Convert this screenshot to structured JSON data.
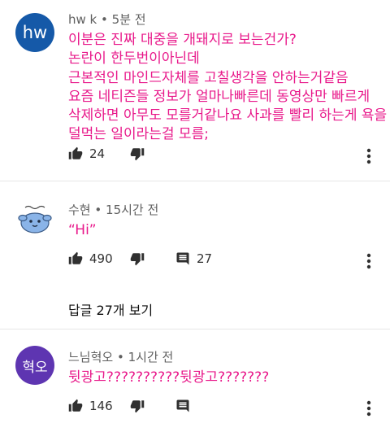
{
  "comments": [
    {
      "avatar_text": "hw",
      "avatar_color": "#1559a8",
      "author": "hw k",
      "time": "5분 전",
      "text": "이분은 진짜 대중을 개돼지로 보는건가?\n 논란이 한두번이아닌데\n근본적인 마인드자체를 고칠생각을 안하는거같음\n요즘 네티즌들 정보가 얼마나빠른데 동영상만 빠르게\n삭제하면 아무도 모를거같나요 사과를 빨리 하는게 욕을\n덜먹는 일이라는걸 모름;",
      "likes": "24",
      "like_icon": "thumbs-up-icon",
      "dislike_icon": "thumbs-down-icon",
      "more_icon": "more-vertical-icon"
    },
    {
      "avatar_text": "",
      "author": "수현",
      "time": "15시간 전",
      "text": "“Hi”",
      "likes": "490",
      "replies_count": "27",
      "replies_link": "답글 27개 보기"
    },
    {
      "avatar_text": "혁오",
      "avatar_color": "#5e35b1",
      "author": "느님혁오",
      "time": "1시간 전",
      "text": "뒷광고??????????뒷광고???????",
      "likes": "146"
    }
  ],
  "separator": "•",
  "accent_text_color": "#e8188a"
}
